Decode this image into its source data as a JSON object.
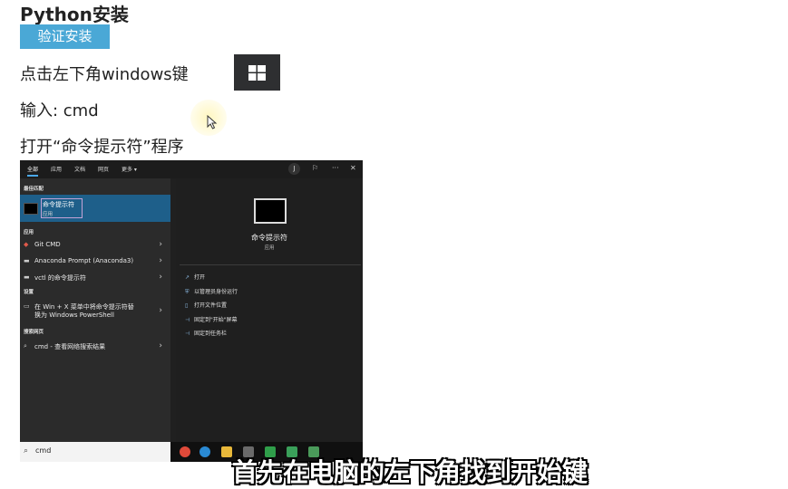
{
  "slide": {
    "title": "Python安装",
    "badge": "验证安装",
    "steps": [
      "点击左下角windows键",
      "输入: cmd",
      "打开“命令提示符”程序"
    ],
    "subtitle": "首先在电脑的左下角找到开始键"
  },
  "search": {
    "tabs": [
      "全部",
      "应用",
      "文档",
      "网页",
      "更多 ▾"
    ],
    "account_initial": "J",
    "sections": {
      "best_match": "最佳匹配",
      "apps": "应用",
      "settings": "设置",
      "web": "搜索网页"
    },
    "best_match": {
      "name": "命令提示符",
      "type": "应用"
    },
    "apps": [
      "Git CMD",
      "Anaconda Prompt (Anaconda3)",
      "vctl 的命令提示符"
    ],
    "settings_item": [
      "在 Win + X 菜单中将命令提示符替",
      "换为 Windows PowerShell"
    ],
    "web_item": "cmd - 查看网络搜索结果",
    "preview": {
      "name": "命令提示符",
      "type": "应用"
    },
    "actions": [
      "打开",
      "以管理员身份运行",
      "打开文件位置",
      "固定到\"开始\"屏幕",
      "固定到任务栏"
    ],
    "query": "cmd"
  },
  "colors": {
    "badge": "#4aa8d6",
    "selection": "#1e5f8a",
    "pane_dark": "#202020"
  },
  "icons": [
    "windows-logo-icon",
    "mouse-cursor-icon",
    "search-icon",
    "chevron-right-icon",
    "cmd-app-icon"
  ]
}
